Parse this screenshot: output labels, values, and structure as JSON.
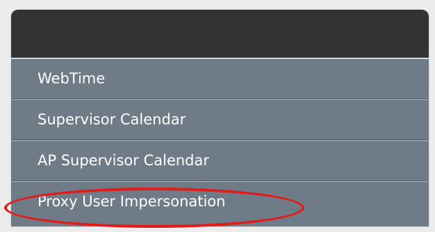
{
  "menu": {
    "items": [
      {
        "label": "WebTime"
      },
      {
        "label": "Supervisor Calendar"
      },
      {
        "label": "AP Supervisor Calendar"
      },
      {
        "label": "Proxy User Impersonation"
      }
    ]
  },
  "annotation": {
    "color": "#e31b1b"
  },
  "colors": {
    "header": "#333333",
    "item_background": "#6f7b86",
    "item_text": "#ffffff",
    "page_background": "#ececec"
  }
}
